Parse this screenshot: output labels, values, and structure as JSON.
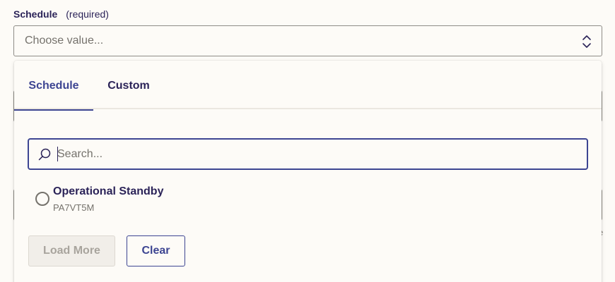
{
  "field": {
    "label": "Schedule",
    "required": "(required)",
    "placeholder": "Choose value..."
  },
  "icons": {
    "select_toggle": "chevron-up-down-icon",
    "search": "search-icon",
    "radio": "radio-unchecked-icon"
  },
  "dropdown": {
    "tabs": [
      {
        "label": "Schedule",
        "active": true
      },
      {
        "label": "Custom",
        "active": false
      }
    ],
    "search": {
      "placeholder": "Search...",
      "value": ""
    },
    "options": [
      {
        "title": "Operational Standby",
        "subtitle": "PA7VT5M",
        "selected": false
      }
    ],
    "load_more_label": "Load More",
    "load_more_disabled": true,
    "clear_label": "Clear"
  },
  "colors": {
    "accent": "#3d4592",
    "text": "#2b2358",
    "muted": "#75726c",
    "background": "#fdfbf7"
  }
}
